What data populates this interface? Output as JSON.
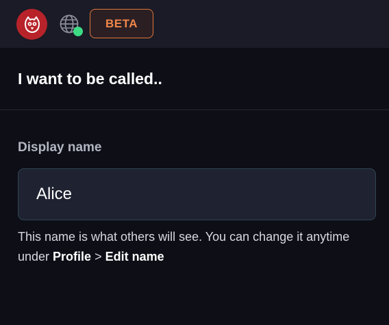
{
  "header": {
    "logo_icon": "owl-logo-icon",
    "globe_icon": "globe-icon",
    "status_color": "#3ddc84",
    "beta_label": "BETA",
    "accent_color": "#f0864a"
  },
  "main": {
    "heading": "I want to be called..",
    "field_label": "Display name",
    "input_value": "Alice",
    "hint_text": "This name is what others will see. You can change it anytime under ",
    "hint_link_1": "Profile",
    "hint_separator": " > ",
    "hint_link_2": "Edit name"
  }
}
